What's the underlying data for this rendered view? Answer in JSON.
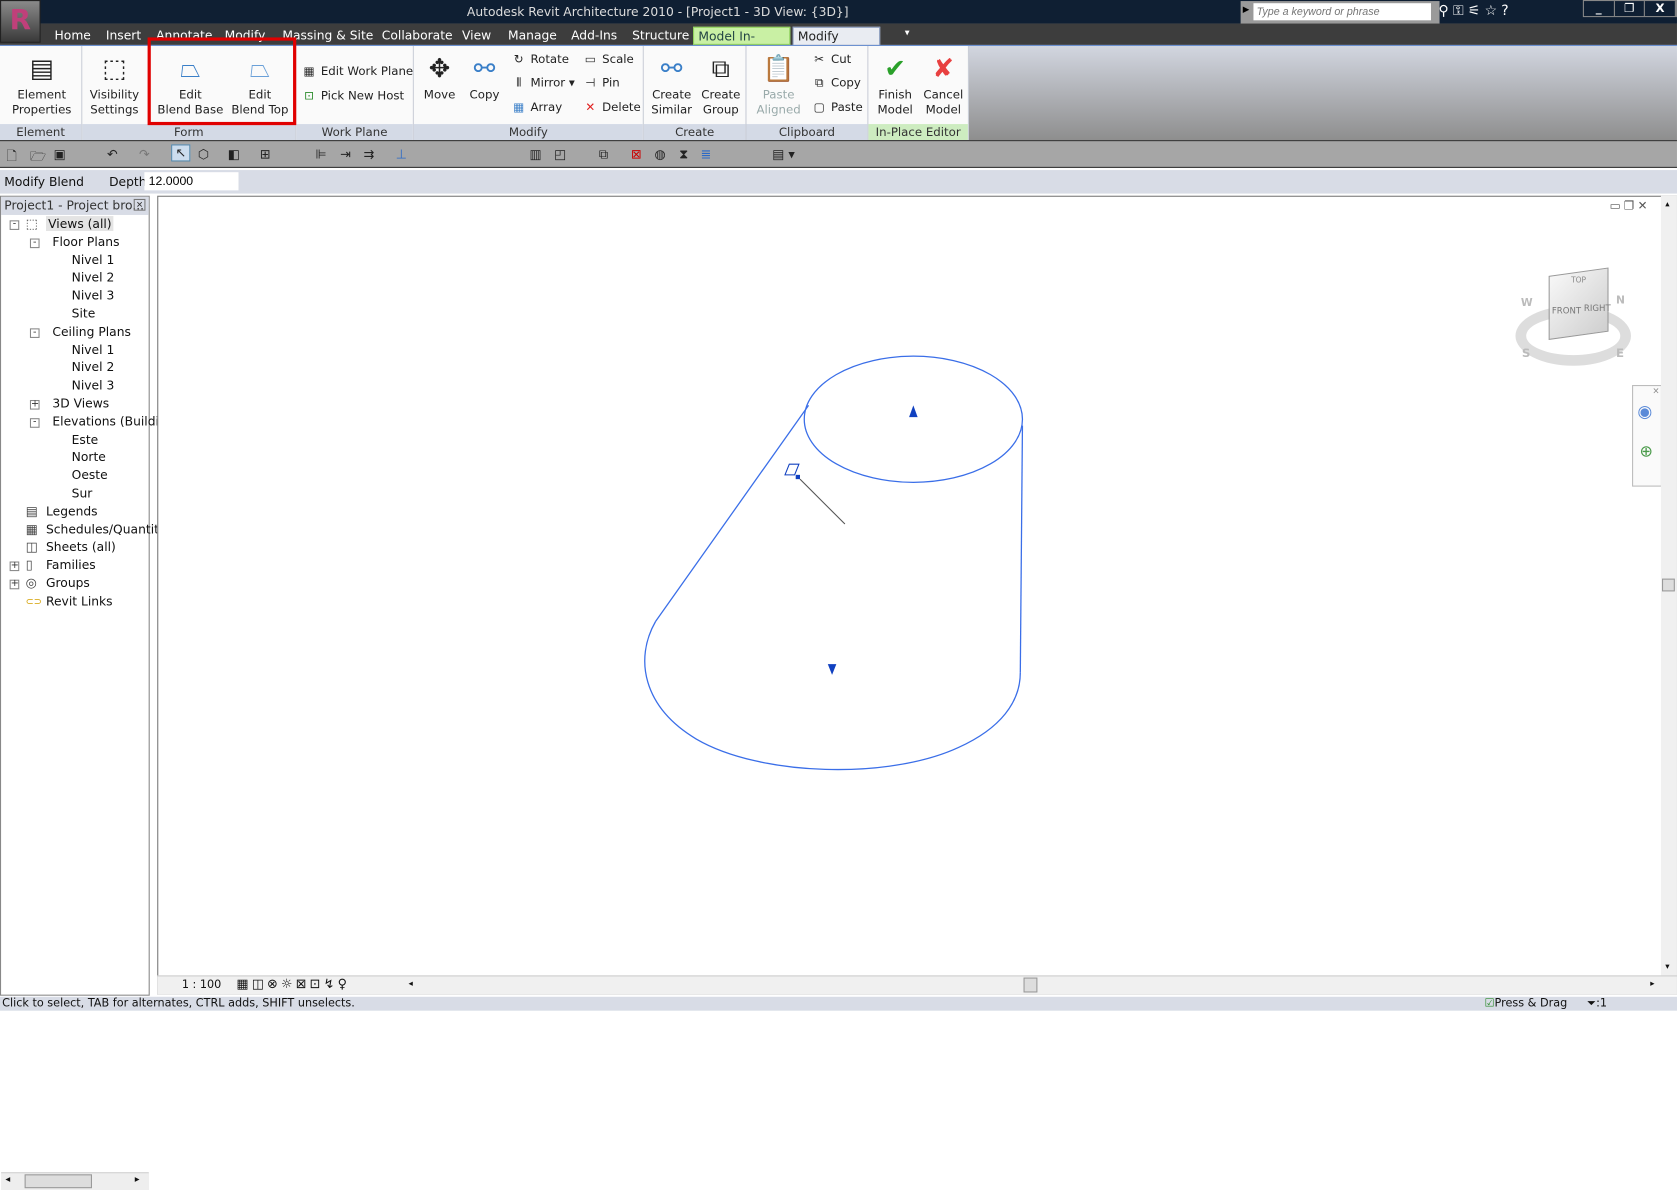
{
  "app": {
    "title": "Autodesk Revit Architecture 2010 - [Project1 - 3D View: {3D}]",
    "logo_letter": "R",
    "search_placeholder": "Type a keyword or phrase",
    "window_buttons": [
      "_",
      "❐",
      "X"
    ]
  },
  "tabs": [
    {
      "label": "Home"
    },
    {
      "label": "Insert"
    },
    {
      "label": "Annotate"
    },
    {
      "label": "Modify"
    },
    {
      "label": "Massing & Site"
    },
    {
      "label": "Collaborate"
    },
    {
      "label": "View"
    },
    {
      "label": "Manage"
    },
    {
      "label": "Add-Ins"
    },
    {
      "label": "Structure"
    },
    {
      "label": "Model In-Place",
      "context": true
    },
    {
      "label": "Modify Blend",
      "selected": true
    }
  ],
  "ribbon": {
    "element": {
      "label": "Element",
      "properties": "Element\nProperties"
    },
    "form": {
      "label": "Form",
      "visibility": "Visibility\nSettings",
      "edit_base": "Edit\nBlend Base",
      "edit_top": "Edit\nBlend Top"
    },
    "work_plane": {
      "label": "Work Plane",
      "edit": "Edit Work Plane",
      "pick": "Pick New Host"
    },
    "modify": {
      "label": "Modify",
      "move": "Move",
      "copy": "Copy",
      "rotate": "Rotate",
      "mirror": "Mirror",
      "array": "Array",
      "scale": "Scale",
      "pin": "Pin",
      "delete": "Delete"
    },
    "create": {
      "label": "Create",
      "similar": "Create\nSimilar",
      "group": "Create\nGroup"
    },
    "clipboard": {
      "label": "Clipboard",
      "paste_aligned": "Paste\nAligned",
      "cut": "Cut",
      "copy": "Copy",
      "paste": "Paste"
    },
    "inplace": {
      "label": "In-Place Editor",
      "finish": "Finish\nModel",
      "cancel": "Cancel\nModel"
    }
  },
  "options": {
    "mode": "Modify Blend",
    "depth_label": "Depth",
    "depth_value": "12.0000"
  },
  "browser": {
    "title": "Project1 - Project bro...",
    "items": [
      {
        "label": "Views (all)",
        "level": 0,
        "exp": "-"
      },
      {
        "label": "Floor Plans",
        "level": 1,
        "exp": "-"
      },
      {
        "label": "Nivel 1",
        "level": 2
      },
      {
        "label": "Nivel 2",
        "level": 2
      },
      {
        "label": "Nivel 3",
        "level": 2
      },
      {
        "label": "Site",
        "level": 2
      },
      {
        "label": "Ceiling Plans",
        "level": 1,
        "exp": "-"
      },
      {
        "label": "Nivel 1",
        "level": 2
      },
      {
        "label": "Nivel 2",
        "level": 2
      },
      {
        "label": "Nivel 3",
        "level": 2
      },
      {
        "label": "3D Views",
        "level": 1,
        "exp": "+"
      },
      {
        "label": "Elevations (Buildir",
        "level": 1,
        "exp": "-"
      },
      {
        "label": "Este",
        "level": 2
      },
      {
        "label": "Norte",
        "level": 2
      },
      {
        "label": "Oeste",
        "level": 2
      },
      {
        "label": "Sur",
        "level": 2
      },
      {
        "label": "Legends",
        "level": 0
      },
      {
        "label": "Schedules/Quantit",
        "level": 0
      },
      {
        "label": "Sheets (all)",
        "level": 0
      },
      {
        "label": "Families",
        "level": 0,
        "exp": "+"
      },
      {
        "label": "Groups",
        "level": 0,
        "exp": "+"
      },
      {
        "label": "Revit Links",
        "level": 0
      }
    ]
  },
  "viewcube": {
    "top": "TOP",
    "front": "FRONT",
    "right": "RIGHT",
    "compass": [
      "W",
      "N",
      "S",
      "E"
    ]
  },
  "view": {
    "scale": "1 : 100",
    "shape_color": "#3a6ee8"
  },
  "status": {
    "hint": "Click to select, TAB for alternates, CTRL adds, SHIFT unselects.",
    "press_drag": "Press & Drag",
    "filter_count": ":1"
  }
}
